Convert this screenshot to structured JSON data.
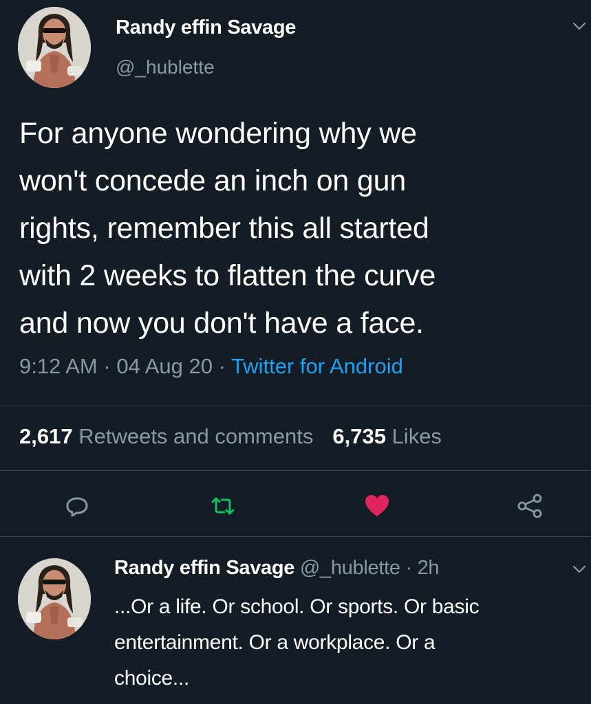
{
  "tweet": {
    "author_name": "Randy effin Savage",
    "author_handle": "@_hublette",
    "text_lines": [
      "For anyone wondering why we",
      "won't concede an inch on gun",
      "rights, remember this all started",
      "with 2 weeks to flatten the curve",
      "and now you don't have a face."
    ],
    "time": "9:12 AM",
    "separator": "·",
    "date": "04 Aug 20",
    "source": "Twitter for Android",
    "retweets_count": "2,617",
    "retweets_label": "Retweets and comments",
    "likes_count": "6,735",
    "likes_label": "Likes"
  },
  "actions": {
    "reply_icon": "reply-bubble-icon",
    "retweet_icon": "retweet-icon",
    "like_icon": "heart-icon",
    "share_icon": "share-icon",
    "retweet_color": "#17bf63",
    "like_color": "#e0245e"
  },
  "reply": {
    "author_name": "Randy effin Savage",
    "author_handle": "@_hublette",
    "separator": "·",
    "time_ago": "2h",
    "text_lines": [
      "...Or a life. Or school. Or sports. Or basic",
      "entertainment. Or a workplace. Or a",
      "choice..."
    ]
  },
  "colors": {
    "background": "#141d26",
    "secondary_text": "#8899a6",
    "link": "#1da1f2",
    "divider": "#38444d"
  }
}
